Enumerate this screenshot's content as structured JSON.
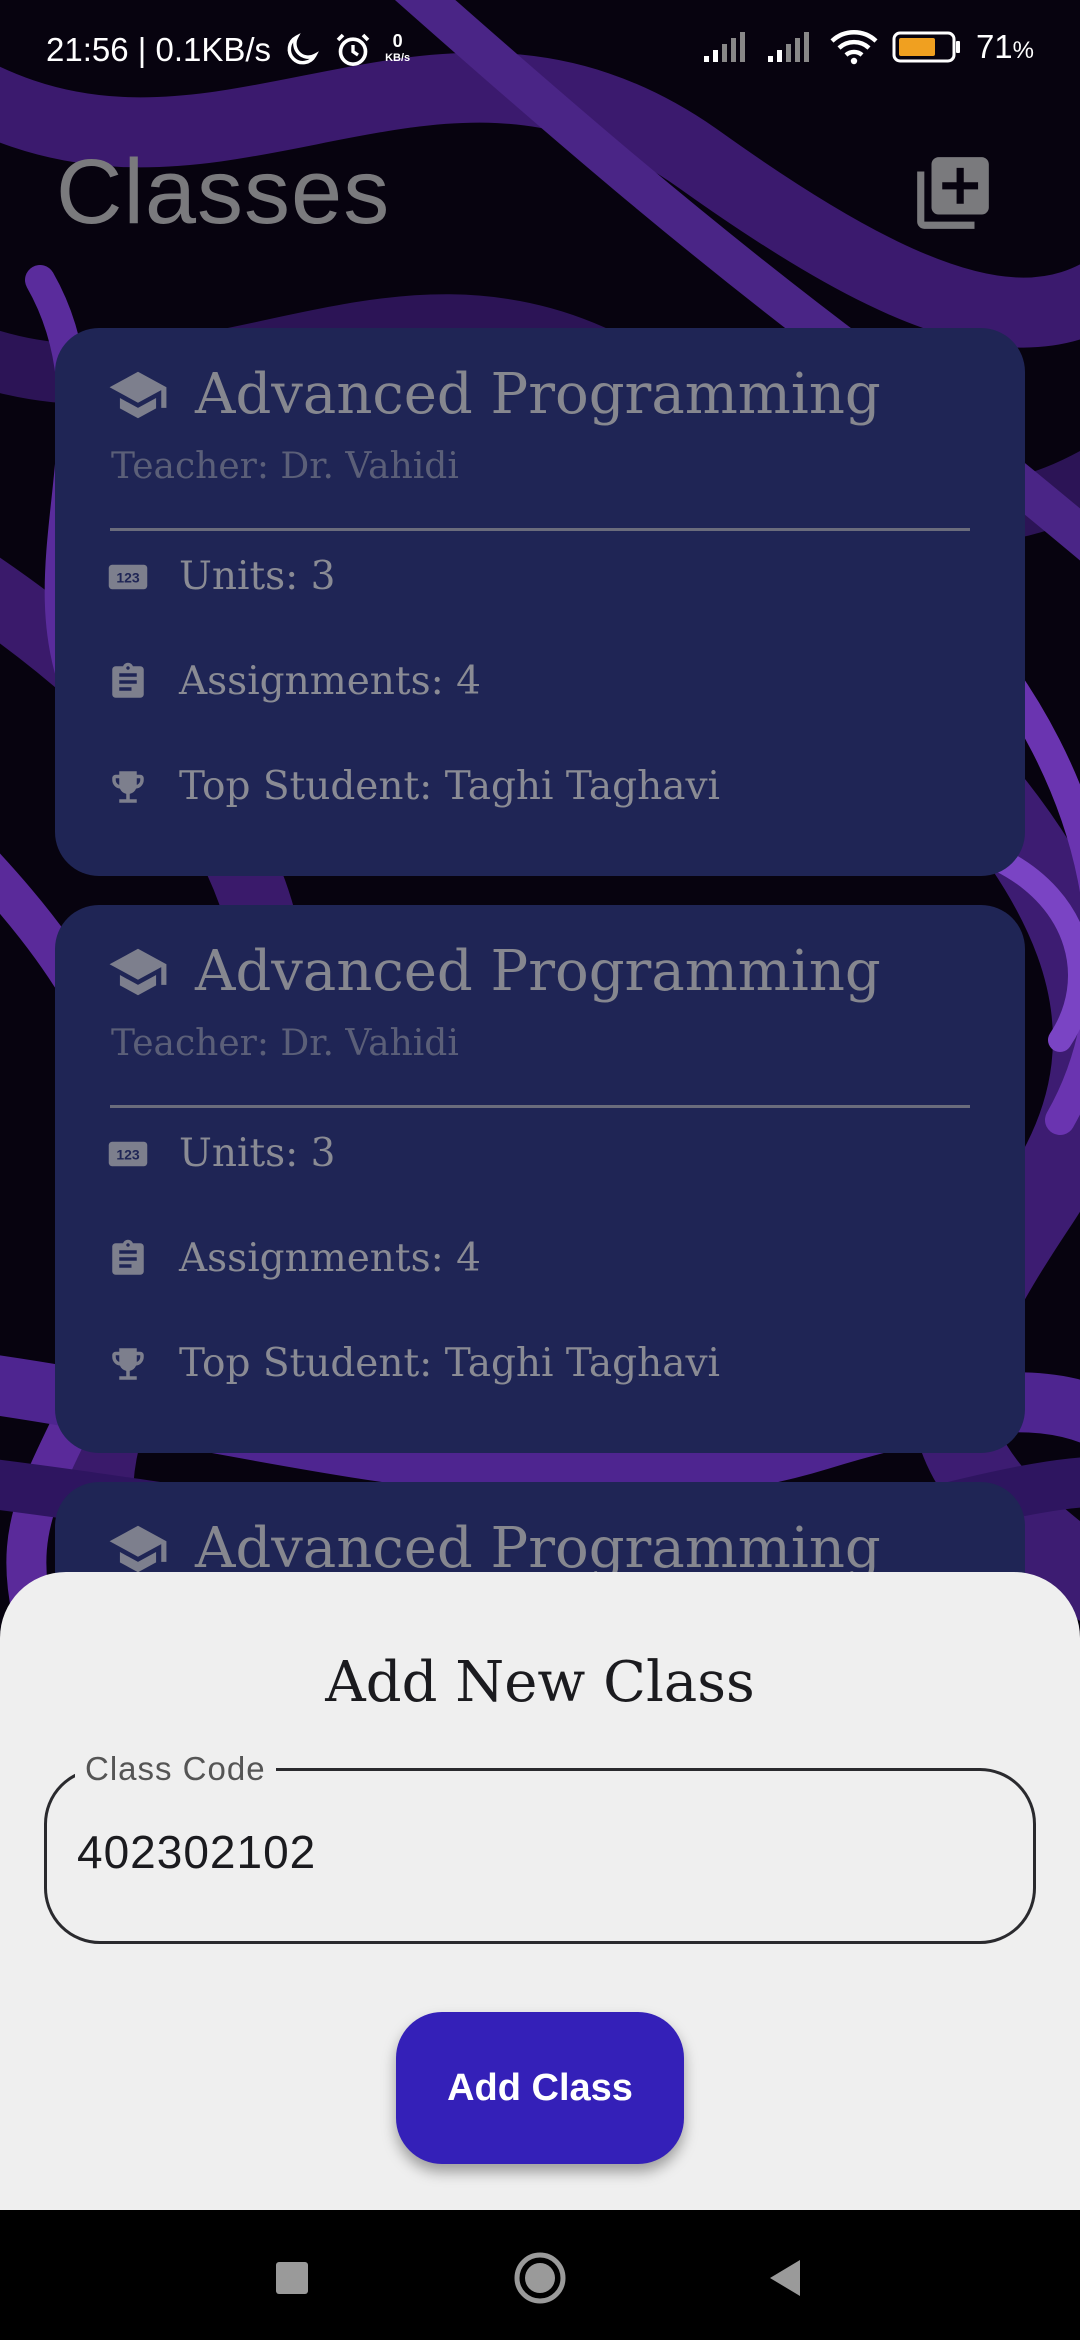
{
  "status_bar": {
    "time_and_speed": "21:56 | 0.1KB/s",
    "net_value": "0",
    "net_unit": "KB/s",
    "battery": "71",
    "battery_unit": "%"
  },
  "header": {
    "title": "Classes"
  },
  "cards": [
    {
      "title": "Advanced Programming",
      "teacher": "Teacher: Dr. Vahidi",
      "units": "Units: 3",
      "assignments": "Assignments: 4",
      "top_student": "Top Student: Taghi Taghavi"
    },
    {
      "title": "Advanced Programming",
      "teacher": "Teacher: Dr. Vahidi",
      "units": "Units: 3",
      "assignments": "Assignments: 4",
      "top_student": "Top Student: Taghi Taghavi"
    },
    {
      "title": "Advanced Programming"
    }
  ],
  "sheet": {
    "title": "Add New Class",
    "field_label": "Class Code",
    "field_value": "402302102",
    "button_label": "Add Class"
  },
  "icons": {
    "header_add": "add-to-library-icon",
    "card_title": "school-icon",
    "units": "numbers-icon",
    "assignments": "clipboard-icon",
    "top_student": "trophy-icon"
  },
  "colors": {
    "card_bg": "#1f2555",
    "sheet_bg": "#efefef",
    "button_bg": "#3420b8",
    "battery_fill": "#f0a020"
  }
}
